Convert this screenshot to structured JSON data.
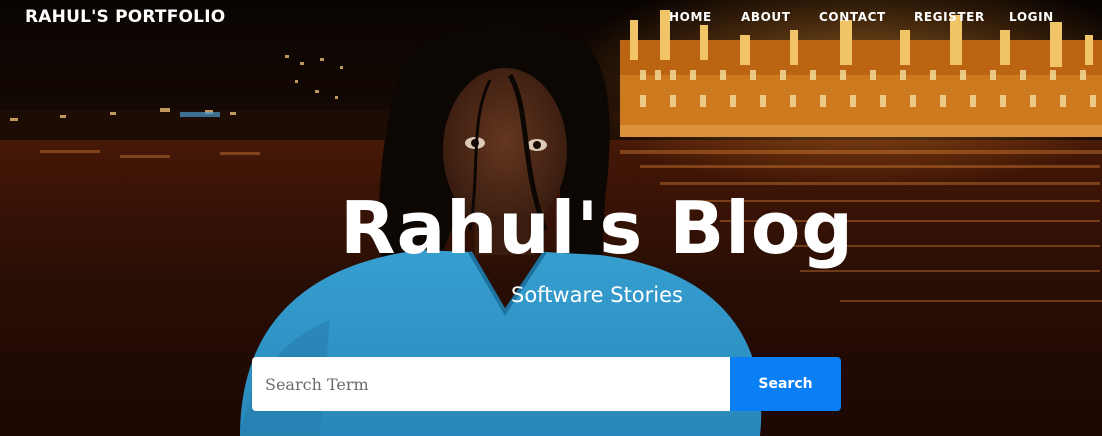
{
  "navbar": {
    "brand": "RAHUL'S PORTFOLIO",
    "links": [
      {
        "label": "HOME"
      },
      {
        "label": "ABOUT"
      },
      {
        "label": "CONTACT"
      },
      {
        "label": "REGISTER"
      },
      {
        "label": "LOGIN"
      }
    ]
  },
  "hero": {
    "title": "Rahul's Blog",
    "subtitle": "Software Stories"
  },
  "search": {
    "placeholder": "Search Term",
    "value": "",
    "button_label": "Search"
  },
  "colors": {
    "accent": "#0a7ff5",
    "text": "#ffffff"
  }
}
